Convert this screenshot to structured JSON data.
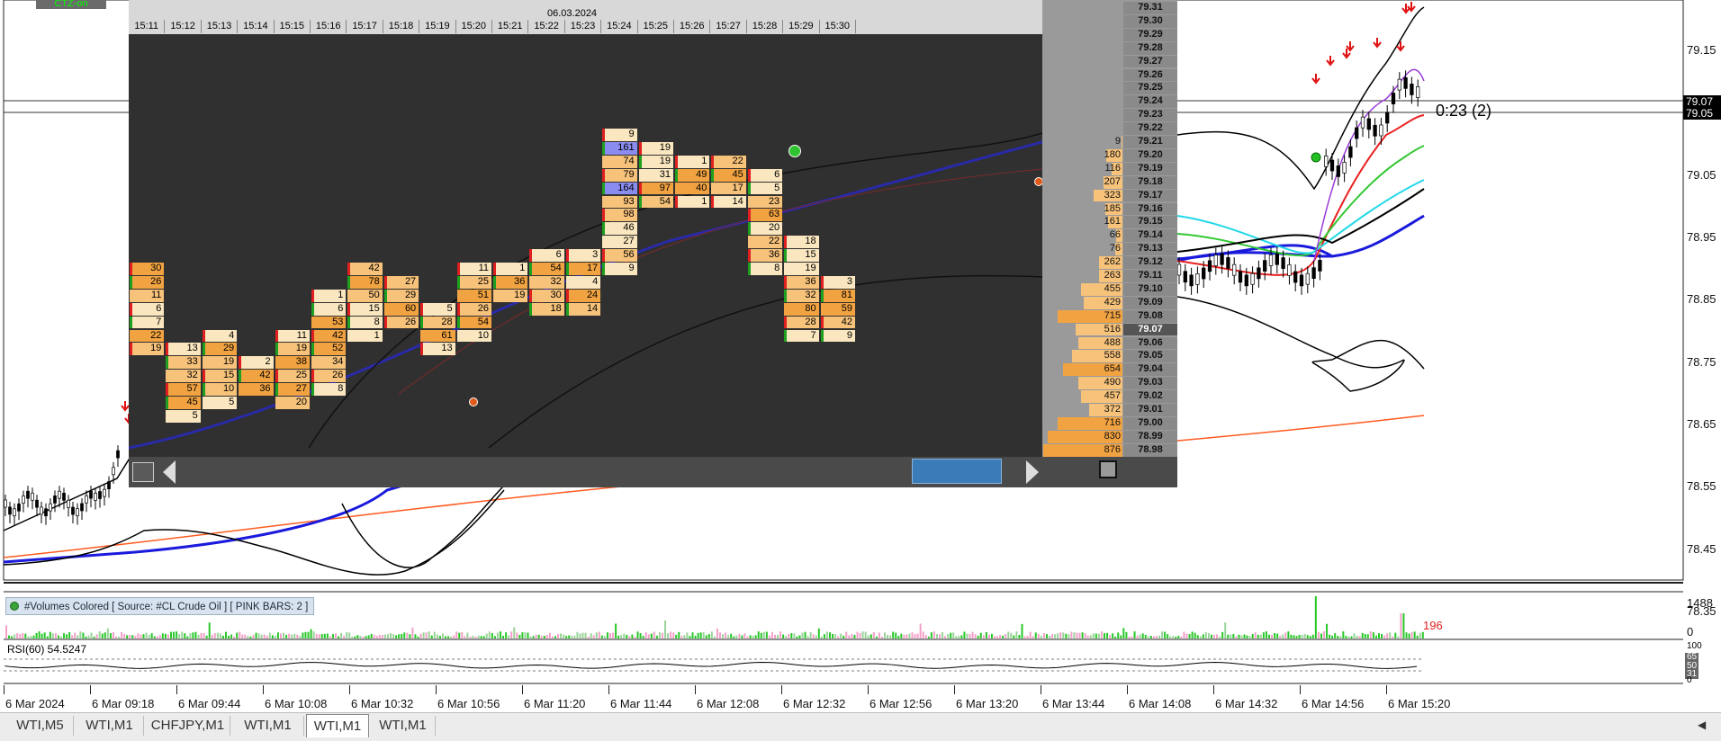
{
  "colors": {
    "bg": "#ffffff",
    "panel": "#303030",
    "ladder": "#9a9a9a",
    "cell_light": "#fbe7bf",
    "cell_mid": "#f7c27a",
    "cell_dark": "#f2a341",
    "cell_blue": "#8a8cf0",
    "bid_red": "#e02020",
    "ask_green": "#20a020"
  },
  "instrument_badge": "CTZ-on",
  "footprint": {
    "date": "06.03.2024",
    "time_headers": [
      "15:11",
      "15:12",
      "15:13",
      "15:14",
      "15:15",
      "15:16",
      "15:17",
      "15:18",
      "15:19",
      "15:20",
      "15:21",
      "15:22",
      "15:23",
      "15:24",
      "15:25",
      "15:26",
      "15:27",
      "15:28",
      "15:29",
      "15:30"
    ],
    "columns": [
      {
        "x": 0,
        "start": 0,
        "values": [
          30,
          26,
          11,
          6,
          7,
          22,
          19
        ]
      },
      {
        "x": 1,
        "start": 6,
        "values": [
          13,
          33,
          32,
          57,
          45,
          5
        ]
      },
      {
        "x": 2,
        "start": 5,
        "values": [
          4,
          29,
          19,
          15,
          10,
          5
        ]
      },
      {
        "x": 3,
        "start": 7,
        "values": [
          2,
          42,
          36
        ]
      },
      {
        "x": 4,
        "start": 5,
        "values": [
          11,
          19,
          38,
          25,
          27,
          20
        ]
      },
      {
        "x": 5,
        "start": 2,
        "values": [
          1,
          6,
          53,
          42,
          52,
          34,
          26,
          8
        ]
      },
      {
        "x": 6,
        "start": 0,
        "values": [
          42,
          78,
          50,
          15,
          8,
          1
        ]
      },
      {
        "x": 7,
        "start": 1,
        "values": [
          27,
          29,
          60,
          26
        ]
      },
      {
        "x": 8,
        "start": 3,
        "values": [
          5,
          28,
          61,
          13
        ]
      },
      {
        "x": 9,
        "start": 0,
        "values": [
          11,
          25,
          51,
          26,
          54,
          10
        ]
      },
      {
        "x": 10,
        "start": 0,
        "values": [
          1,
          36,
          19
        ]
      },
      {
        "x": 11,
        "start": -1,
        "values": [
          6,
          54,
          32,
          30,
          18
        ]
      },
      {
        "x": 12,
        "start": -1,
        "values": [
          3,
          17,
          4,
          24,
          14
        ]
      },
      {
        "x": 13,
        "start": -10,
        "values": [
          9,
          161,
          74,
          79,
          164,
          93,
          98,
          46,
          27,
          56,
          9
        ]
      },
      {
        "x": 14,
        "start": -9,
        "values": [
          19,
          19,
          31,
          97,
          54
        ]
      },
      {
        "x": 15,
        "start": -8,
        "values": [
          1,
          49,
          40,
          1
        ]
      },
      {
        "x": 16,
        "start": -8,
        "values": [
          22,
          45,
          17,
          14
        ]
      },
      {
        "x": 17,
        "start": -7,
        "values": [
          6,
          5,
          23,
          63,
          20,
          22,
          36,
          8
        ]
      },
      {
        "x": 18,
        "start": -2,
        "values": [
          18,
          15,
          19,
          36,
          32,
          80,
          28,
          7
        ]
      },
      {
        "x": 19,
        "start": 1,
        "values": [
          3,
          81,
          59,
          42,
          9
        ]
      }
    ]
  },
  "ladder": {
    "prices": [
      "79.31",
      "79.30",
      "79.29",
      "79.28",
      "79.27",
      "79.26",
      "79.25",
      "79.24",
      "79.23",
      "79.22",
      "79.21",
      "79.20",
      "79.19",
      "79.18",
      "79.17",
      "79.16",
      "79.15",
      "79.14",
      "79.13",
      "79.12",
      "79.11",
      "79.10",
      "79.09",
      "79.08",
      "79.07",
      "79.06",
      "79.05",
      "79.04",
      "79.03",
      "79.02",
      "79.01",
      "79.00",
      "78.99",
      "78.98"
    ],
    "volumes": [
      "",
      "",
      "",
      "",
      "",
      "",
      "",
      "",
      "",
      "",
      "9",
      "180",
      "116",
      "207",
      "323",
      "185",
      "161",
      "66",
      "76",
      "262",
      "263",
      "455",
      "429",
      "715",
      "516",
      "488",
      "558",
      "654",
      "490",
      "457",
      "372",
      "716",
      "830",
      "876"
    ]
  },
  "price_axis": {
    "labels": [
      "79.15",
      "79.05",
      "78.95",
      "78.85",
      "78.75",
      "78.65",
      "78.55",
      "78.45",
      "78.35"
    ],
    "current": "79.07",
    "current2": "79.05"
  },
  "countdown": "0:23 (2)",
  "time_axis": [
    "6 Mar 2024",
    "6 Mar 09:18",
    "6 Mar 09:44",
    "6 Mar 10:08",
    "6 Mar 10:32",
    "6 Mar 10:56",
    "6 Mar 11:20",
    "6 Mar 11:44",
    "6 Mar 12:08",
    "6 Mar 12:32",
    "6 Mar 12:56",
    "6 Mar 13:20",
    "6 Mar 13:44",
    "6 Mar 14:08",
    "6 Mar 14:32",
    "6 Mar 14:56",
    "6 Mar 15:20"
  ],
  "volumes_indicator": {
    "label": "#Volumes Colored [ Source: #CL Crude Oil ]  [ PINK BARS: 2 ]",
    "max": "1488",
    "min": "0",
    "last": "196"
  },
  "rsi": {
    "label": "RSI(60) 54.5247",
    "levels": [
      "100",
      "65",
      "50",
      "31",
      "0"
    ]
  },
  "tabs": [
    "WTI,M5",
    "WTI,M1",
    "CHFJPY,M1",
    "WTI,M1",
    "WTI,M1",
    "WTI,M1"
  ],
  "active_tab": 4
}
